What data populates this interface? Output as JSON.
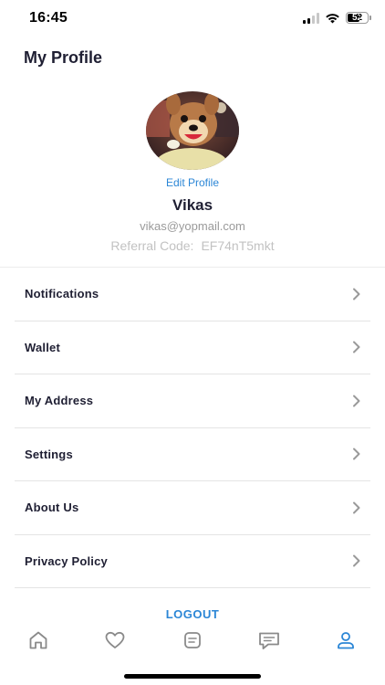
{
  "status_bar": {
    "time": "16:45",
    "battery": "52",
    "icons": [
      "signal-icon",
      "wifi-icon",
      "battery-icon"
    ]
  },
  "header": {
    "title": "My Profile"
  },
  "profile": {
    "edit_label": "Edit Profile",
    "name": "Vikas",
    "email": "vikas@yopmail.com",
    "referral_label": "Referral Code:",
    "referral_code": "EF74nT5mkt"
  },
  "menu": {
    "items": [
      {
        "label": "Notifications"
      },
      {
        "label": "Wallet"
      },
      {
        "label": "My Address"
      },
      {
        "label": "Settings"
      },
      {
        "label": "About Us"
      },
      {
        "label": "Privacy Policy"
      }
    ]
  },
  "logout_label": "LOGOUT",
  "tab_bar": {
    "tabs": [
      "home-icon",
      "heart-icon",
      "orders-icon",
      "chat-icon",
      "profile-icon"
    ],
    "active_tab": "profile-icon"
  },
  "colors": {
    "accent": "#2b86d6",
    "text_dark": "#1f1f33",
    "text_muted": "#9a9a9a",
    "divider": "#e4e4e4",
    "icon_inactive": "#8a8a8a"
  }
}
